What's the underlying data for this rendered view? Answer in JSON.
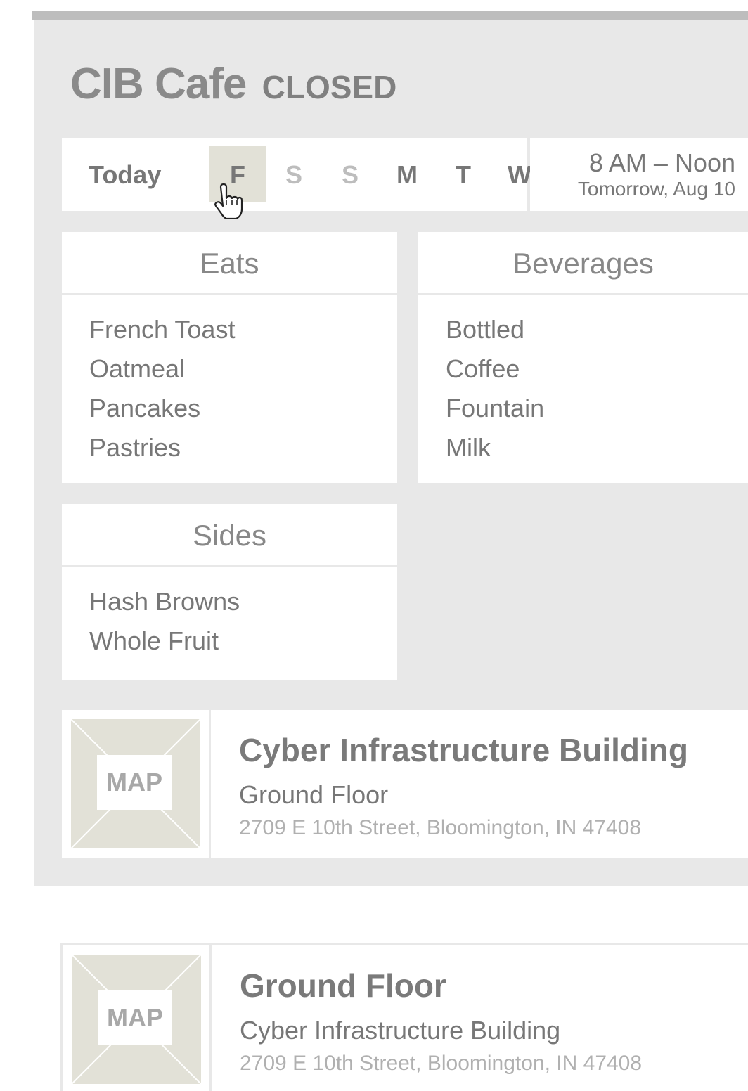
{
  "cafe": {
    "name": "CIB Cafe",
    "status": "CLOSED"
  },
  "days": {
    "today_label": "Today",
    "items": [
      {
        "label": "F",
        "state": "selected"
      },
      {
        "label": "S",
        "state": "disabled"
      },
      {
        "label": "S",
        "state": "disabled"
      },
      {
        "label": "M",
        "state": "normal"
      },
      {
        "label": "T",
        "state": "normal"
      },
      {
        "label": "W",
        "state": "normal"
      }
    ]
  },
  "hours": {
    "time": "8 AM – Noon",
    "date": "Tomorrow, Aug 10"
  },
  "menu": {
    "eats": {
      "title": "Eats",
      "items": [
        "French Toast",
        "Oatmeal",
        "Pancakes",
        "Pastries"
      ]
    },
    "beverages": {
      "title": "Beverages",
      "items": [
        "Bottled",
        "Coffee",
        "Fountain",
        "Milk"
      ]
    },
    "sides": {
      "title": "Sides",
      "items": [
        "Hash Browns",
        "Whole Fruit"
      ]
    }
  },
  "location_primary": {
    "map_label": "MAP",
    "title": "Cyber Infrastructure Building",
    "subtitle": "Ground Floor",
    "address": "2709 E 10th Street, Bloomington, IN 47408"
  },
  "location_secondary": {
    "map_label": "MAP",
    "title": "Ground Floor",
    "subtitle": "Cyber Infrastructure Building",
    "address": "2709 E 10th Street, Bloomington, IN 47408"
  },
  "colors": {
    "background": "#e8e8e8",
    "panel": "#ffffff",
    "selected_chip": "#e2e1d7",
    "map_fill": "#e2e1d7",
    "topbar": "#bdbdbd"
  },
  "icons": {
    "cursor": "hand-pointer-icon"
  }
}
